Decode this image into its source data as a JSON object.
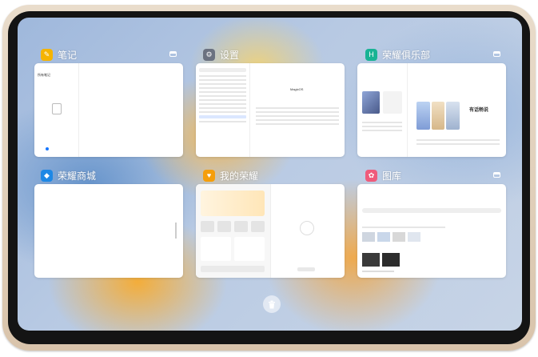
{
  "apps": [
    {
      "name": "笔记",
      "icon": "notes-app-icon",
      "color": "#f5b400",
      "content": {
        "folder_label": "所有笔记"
      }
    },
    {
      "name": "设置",
      "icon": "settings-gear-icon",
      "color": "#6b7280",
      "content": {
        "brand": "MagicOS"
      }
    },
    {
      "name": "荣耀俱乐部",
      "icon": "honor-club-icon",
      "color": "#19b394",
      "content": {
        "promo": "有话畅说"
      }
    },
    {
      "name": "荣耀商城",
      "icon": "honor-mall-icon",
      "color": "#1e88e5",
      "content": {}
    },
    {
      "name": "我的荣耀",
      "icon": "my-honor-icon",
      "color": "#f59e0b",
      "content": {}
    },
    {
      "name": "图库",
      "icon": "gallery-icon",
      "color": "#ef5b7b",
      "content": {}
    }
  ],
  "colors": {
    "accent": "#1677ff"
  }
}
